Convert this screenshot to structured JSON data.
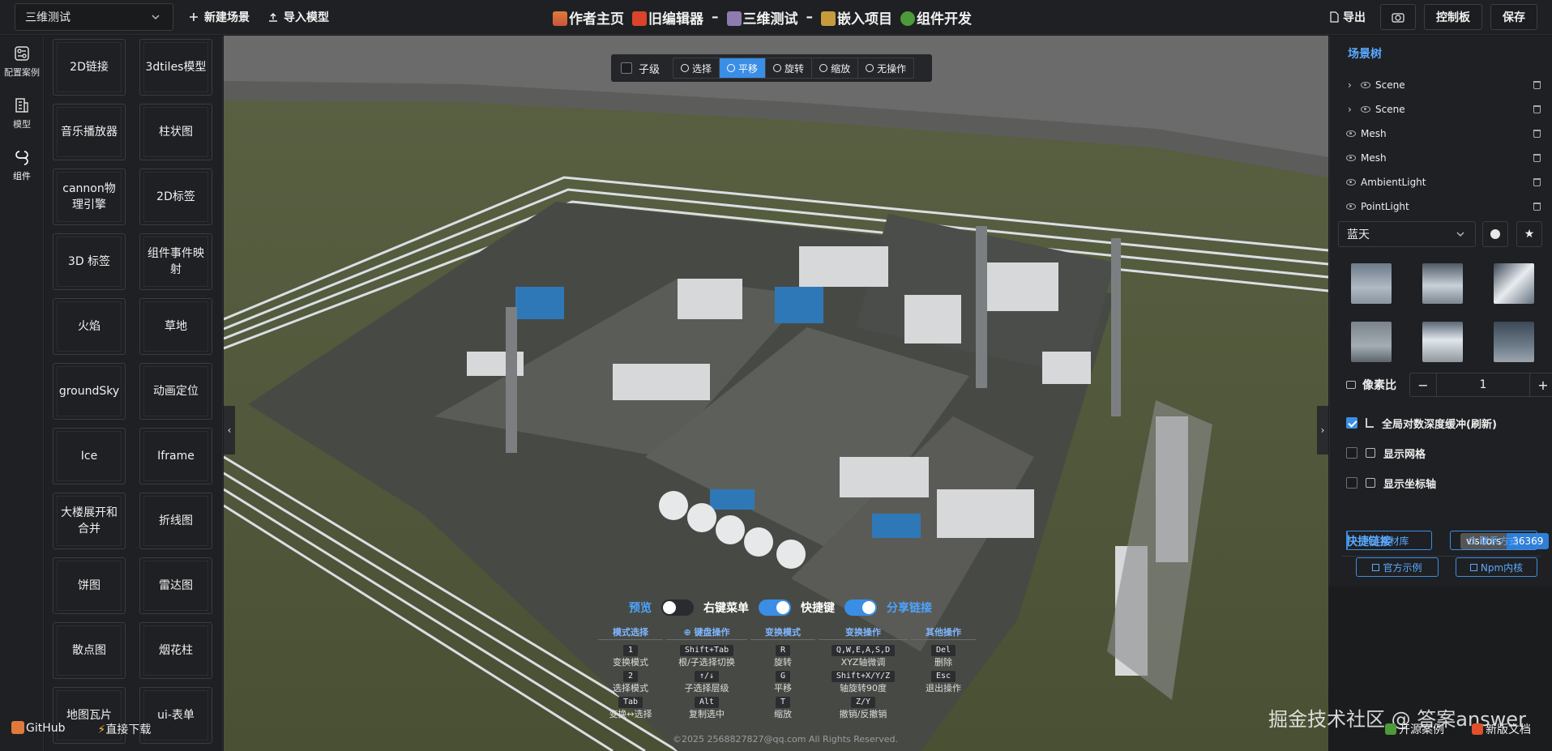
{
  "topbar": {
    "scene_select": "三维测试",
    "new_scene": "新建场景",
    "import_model": "导入模型",
    "home": "作者主页",
    "old_editor": "旧编辑器",
    "sep1": "–",
    "project": "三维测试",
    "sep2": "–",
    "embed": "嵌入项目",
    "devcomp": "组件开发",
    "export": "导出",
    "console": "控制板",
    "save": "保存"
  },
  "leftnav": [
    {
      "label": "配置案例",
      "icon": "config-icon"
    },
    {
      "label": "模型",
      "icon": "model-icon"
    },
    {
      "label": "组件",
      "icon": "component-icon"
    }
  ],
  "components": [
    "2D链接",
    "3dtiles模型",
    "音乐播放器",
    "柱状图",
    "cannon物理引擎",
    "2D标签",
    "3D 标签",
    "组件事件映射",
    "火焰",
    "草地",
    "groundSky",
    "动画定位",
    "Ice",
    "Iframe",
    "大楼展开和合并",
    "折线图",
    "饼图",
    "雷达图",
    "散点图",
    "烟花柱",
    "地图瓦片",
    "ui-表单"
  ],
  "bottom_links": {
    "github": "GitHub",
    "download": "直接下载"
  },
  "ops": {
    "child": "子级",
    "modes": [
      "选择",
      "平移",
      "旋转",
      "缩放",
      "无操作"
    ],
    "active_mode": "平移"
  },
  "toggles": {
    "preview": "预览",
    "context_menu": "右键菜单",
    "shortcut": "快捷键",
    "share": "分享链接"
  },
  "keymap": [
    {
      "head": "模式选择",
      "rows": [
        {
          "key": "1",
          "desc": "变换模式"
        },
        {
          "key": "2",
          "desc": "选择模式"
        },
        {
          "key": "Tab",
          "desc": "变换↔选择"
        }
      ]
    },
    {
      "head": "键盘操作",
      "rows": [
        {
          "key": "Shift+Tab",
          "desc": "根/子选择切换"
        },
        {
          "key": "↑/↓",
          "desc": "子选择层级"
        },
        {
          "key": "Alt",
          "desc": "复制选中"
        }
      ]
    },
    {
      "head": "变换模式",
      "rows": [
        {
          "key": "R",
          "desc": "旋转"
        },
        {
          "key": "G",
          "desc": "平移"
        },
        {
          "key": "T",
          "desc": "缩放"
        }
      ]
    },
    {
      "head": "变换操作",
      "rows": [
        {
          "key": "Q,W,E,A,S,D",
          "desc": "XYZ轴微调"
        },
        {
          "key": "Shift+X/Y/Z",
          "desc": "轴旋转90度"
        },
        {
          "key": "Z/Y",
          "desc": "撤销/反撤销"
        }
      ]
    },
    {
      "head": "其他操作",
      "rows": [
        {
          "key": "Del",
          "desc": "删除"
        },
        {
          "key": "Esc",
          "desc": "退出操作"
        },
        {
          "key": "",
          "desc": ""
        }
      ]
    }
  ],
  "copyright": "©2025 2568827827@qq.com All Rights Reserved.",
  "right": {
    "title": "场景树",
    "tree": [
      {
        "label": "Scene",
        "expandable": true
      },
      {
        "label": "Scene",
        "expandable": true
      },
      {
        "label": "Mesh",
        "expandable": false
      },
      {
        "label": "Mesh",
        "expandable": false
      },
      {
        "label": "AmbientLight",
        "expandable": false
      },
      {
        "label": "PointLight",
        "expandable": false
      }
    ],
    "sky_select": "蓝天",
    "pixel_ratio_label": "像素比",
    "pixel_ratio_value": "1",
    "options": [
      {
        "label": "全局对数深度缓冲(刷新)",
        "checked": true
      },
      {
        "label": "显示网格",
        "checked": false
      },
      {
        "label": "显示坐标轴",
        "checked": false
      }
    ],
    "quick_links": "快捷链接",
    "visitors_label": "visitors",
    "visitors_count": "36369",
    "links": [
      "素材库",
      "联系方式",
      "官方示例",
      "Npm内核"
    ]
  },
  "watermark": "掘金技术社区 @ 答案answer",
  "bottom_right": {
    "open_source": "开源案例",
    "new_docs": "新版文档"
  },
  "colors": {
    "accent": "#3a8ee6",
    "link": "#5aa9ff",
    "bg": "#1f2023"
  }
}
